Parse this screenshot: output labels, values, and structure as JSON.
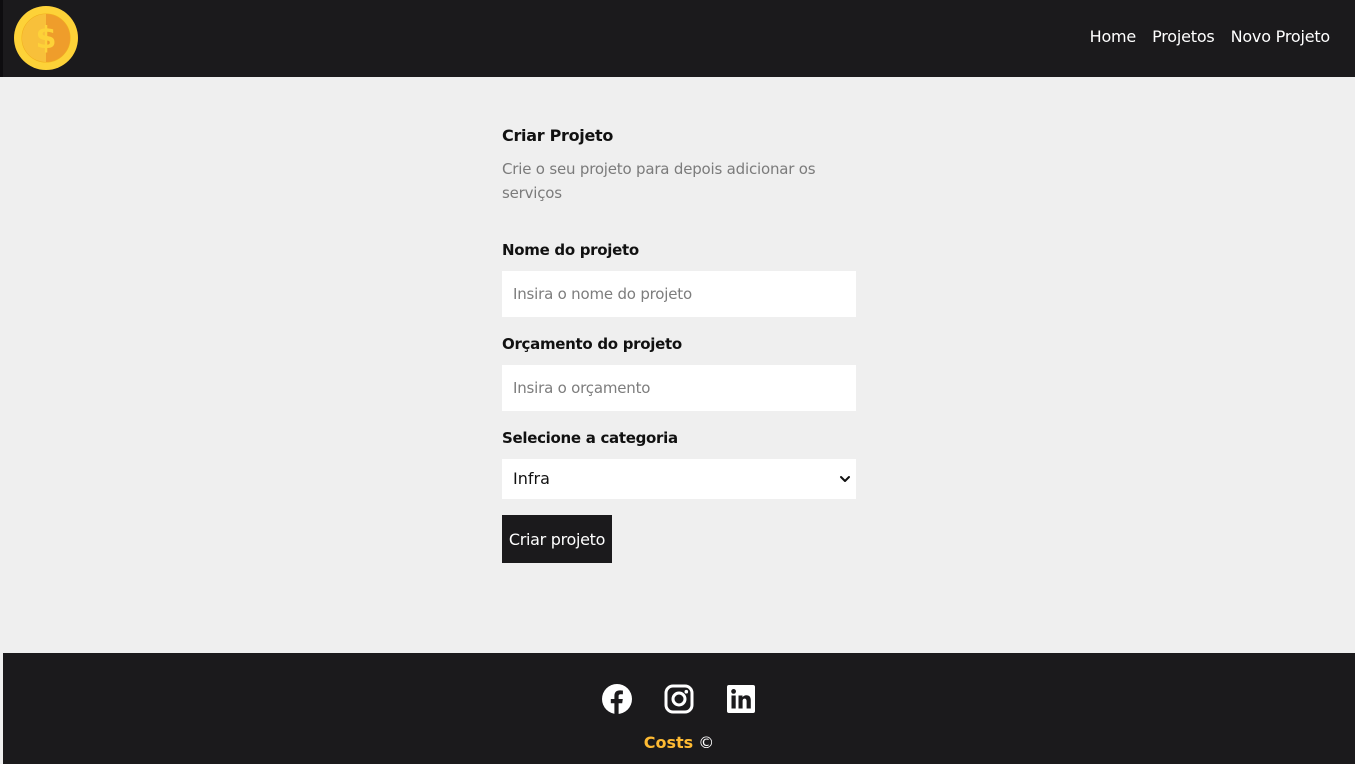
{
  "navbar": {
    "logo_icon": "dollar-coin-icon",
    "links": [
      {
        "label": "Home"
      },
      {
        "label": "Projetos"
      },
      {
        "label": "Novo Projeto"
      }
    ]
  },
  "form": {
    "title": "Criar Projeto",
    "subtitle": "Crie o seu projeto para depois adicionar os serviços",
    "name_label": "Nome do projeto",
    "name_placeholder": "Insira o nome do projeto",
    "budget_label": "Orçamento do projeto",
    "budget_placeholder": "Insira o orçamento",
    "category_label": "Selecione a categoria",
    "category_selected": "Infra",
    "submit_label": "Criar projeto"
  },
  "footer": {
    "social_icons": [
      "facebook-icon",
      "instagram-icon",
      "linkedin-icon"
    ],
    "brand": "Costs",
    "copyright_symbol": "©"
  },
  "colors": {
    "dark": "#1b1a1c",
    "background": "#efefef",
    "accent": "#ffbb33"
  }
}
